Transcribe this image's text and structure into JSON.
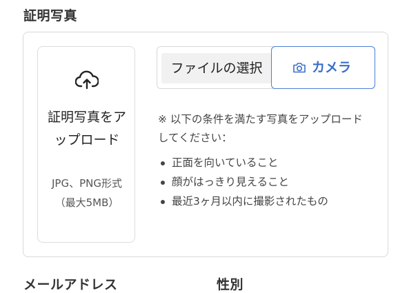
{
  "section": {
    "title": "証明写真"
  },
  "upload": {
    "icon": "cloud-upload-icon",
    "title": "証明写真をアップロード",
    "subtitle": "JPG、PNG形式（最大5MB）"
  },
  "buttons": {
    "file_select_label": "ファイルの選択",
    "camera_icon": "camera-icon",
    "camera_label": "カメラ",
    "accent_color": "#3a6fc8"
  },
  "requirements": {
    "note": "※ 以下の条件を満たす写真をアップロードしてください：",
    "items": [
      "正面を向いていること",
      "顔がはっきり見えること",
      "最近3ヶ月以内に撮影されたもの"
    ]
  },
  "fields": {
    "email_label": "メールアドレス",
    "gender_label": "性別"
  }
}
